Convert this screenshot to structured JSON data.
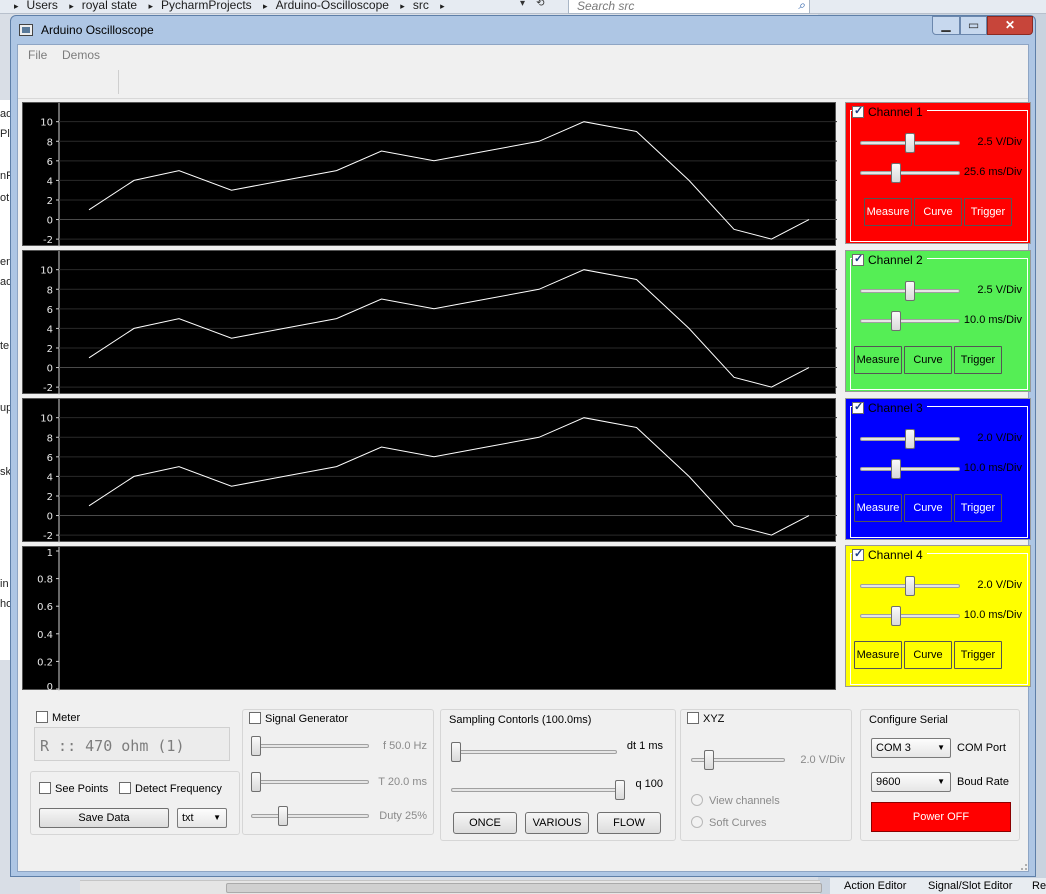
{
  "explorer": {
    "breadcrumb": [
      "Users",
      "royal state",
      "PycharmProjects",
      "Arduino-Oscilloscope",
      "src"
    ],
    "search_placeholder": "Search src"
  },
  "right_panel": {
    "tabs": [
      "Action Editor",
      "Signal/Slot Editor",
      "Re"
    ]
  },
  "window": {
    "title": "Arduino Oscilloscope",
    "menu": [
      "File",
      "Demos"
    ]
  },
  "scopes": [
    {
      "y_ticks": [
        "10",
        "8",
        "6",
        "4",
        "2",
        "0",
        "-2"
      ],
      "y_range": [
        -2.6,
        11.5
      ]
    },
    {
      "y_ticks": [
        "10",
        "8",
        "6",
        "4",
        "2",
        "0",
        "-2"
      ],
      "y_range": [
        -2.6,
        11.5
      ]
    },
    {
      "y_ticks": [
        "10",
        "8",
        "6",
        "4",
        "2",
        "0",
        "-2"
      ],
      "y_range": [
        -2.6,
        11.5
      ]
    },
    {
      "y_ticks": [
        "1",
        "0.8",
        "0.6",
        "0.4",
        "0.2",
        "0"
      ],
      "y_range": [
        0,
        1
      ]
    }
  ],
  "chart_data": {
    "type": "line",
    "y_values": [
      1,
      4,
      5,
      3,
      4,
      5,
      7,
      6,
      7,
      8,
      10,
      9,
      4,
      -1,
      -2,
      0
    ],
    "x_positions": [
      0.04,
      0.1,
      0.16,
      0.23,
      0.3,
      0.37,
      0.43,
      0.5,
      0.57,
      0.64,
      0.7,
      0.77,
      0.84,
      0.9,
      0.95,
      1.0
    ],
    "series_on_scope": [
      true,
      true,
      true,
      false
    ],
    "grid": "horizontal"
  },
  "channels": [
    {
      "label": "Channel 1",
      "checked": true,
      "color": "#ff0000",
      "volts": "2.5 V/Div",
      "time": "25.6 ms/Div",
      "v_pos": 0.5,
      "t_pos": 0.35,
      "buttons": [
        "Measure",
        "Curve",
        "Trigger"
      ]
    },
    {
      "label": "Channel 2",
      "checked": true,
      "color": "#55ee55",
      "volts": "2.5 V/Div",
      "time": "10.0 ms/Div",
      "v_pos": 0.5,
      "t_pos": 0.35,
      "buttons": [
        "Measure",
        "Curve",
        "Trigger"
      ]
    },
    {
      "label": "Channel 3",
      "checked": true,
      "color": "#0000ff",
      "volts": "2.0 V/Div",
      "time": "10.0 ms/Div",
      "v_pos": 0.5,
      "t_pos": 0.35,
      "buttons": [
        "Measure",
        "Curve",
        "Trigger"
      ]
    },
    {
      "label": "Channel 4",
      "checked": true,
      "color": "#ffff00",
      "volts": "2.0 V/Div",
      "time": "10.0 ms/Div",
      "v_pos": 0.5,
      "t_pos": 0.35,
      "buttons": [
        "Measure",
        "Curve",
        "Trigger"
      ]
    }
  ],
  "meter": {
    "label": "Meter",
    "checked": false,
    "reading": "R :: 470 ohm (1)"
  },
  "data_tools": {
    "see_points": "See Points",
    "detect_frequency": "Detect Frequency",
    "save": "Save Data",
    "format": "txt"
  },
  "signal_generator": {
    "label": "Signal Generator",
    "checked": false,
    "f": "f 50.0 Hz",
    "t": "T 20.0 ms",
    "duty": "Duty 25%",
    "f_pos": 0.0,
    "t_pos": 0.0,
    "duty_pos": 0.25
  },
  "sampling": {
    "label": "Sampling Contorls (100.0ms)",
    "dt": "dt 1 ms",
    "q": "q 100",
    "dt_pos": 0.0,
    "q_pos": 1.0,
    "buttons": [
      "ONCE",
      "VARIOUS",
      "FLOW"
    ]
  },
  "xyz": {
    "label": "XYZ",
    "checked": false,
    "volts": "2.0 V/Div",
    "v_pos": 0.15,
    "view_channels": "View channels",
    "soft_curves": "Soft Curves"
  },
  "serial": {
    "label": "Configure Serial",
    "port_value": "COM 3",
    "port_label": "COM Port",
    "baud_value": "9600",
    "baud_label": "Boud Rate",
    "power": "Power OFF",
    "power_color": "#ff0000"
  }
}
